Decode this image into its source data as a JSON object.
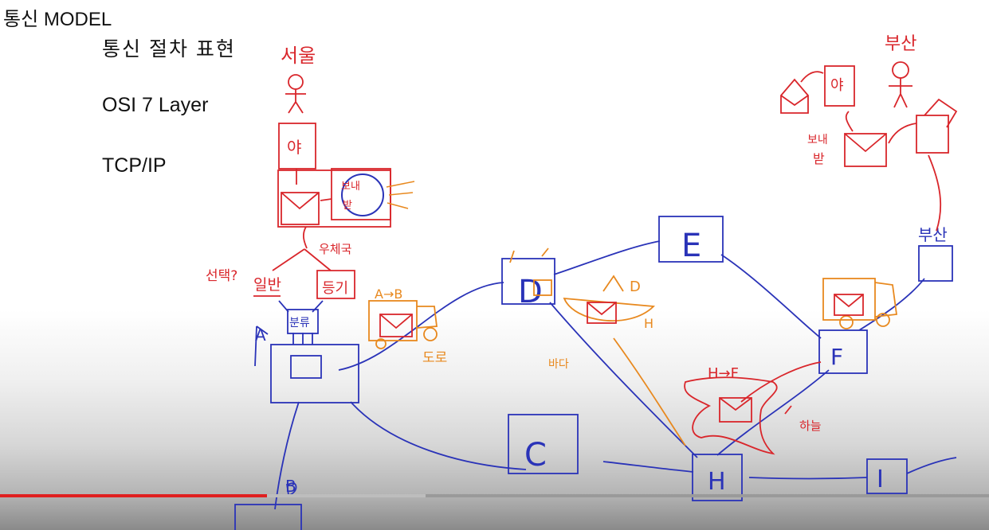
{
  "header": {
    "title": "통신 MODEL"
  },
  "menu": [
    {
      "label": "통신 절차 표현"
    },
    {
      "label": "OSI 7 Layer"
    },
    {
      "label": "TCP/IP"
    }
  ],
  "sketch": {
    "seoul": "서울",
    "busan": "부산",
    "ya_left": "야",
    "ya_right": "야",
    "send_recv_left_1": "보내",
    "send_recv_left_2": "받",
    "send_recv_right_1": "보내",
    "send_recv_right_2": "받",
    "post_office": "우체국",
    "choice_q": "선택?",
    "normal": "일반",
    "registered": "등기",
    "sort": "분류",
    "node_a": "A",
    "node_b": "B",
    "node_c": "C",
    "node_d": "D",
    "node_e": "E",
    "node_f": "F",
    "node_h": "H",
    "node_i": "I",
    "busan_node": "부산",
    "truck_route": "A→B",
    "road": "도로",
    "ship_route": "D",
    "ship_dest": "H",
    "sea": "바다",
    "plane_route": "H→F",
    "sky": "하늘"
  },
  "colors": {
    "red": "#d9262b",
    "blue": "#2a33b8",
    "orange": "#e8891f"
  },
  "player": {
    "played_fraction": 0.27,
    "buffered_fraction": 0.43
  }
}
